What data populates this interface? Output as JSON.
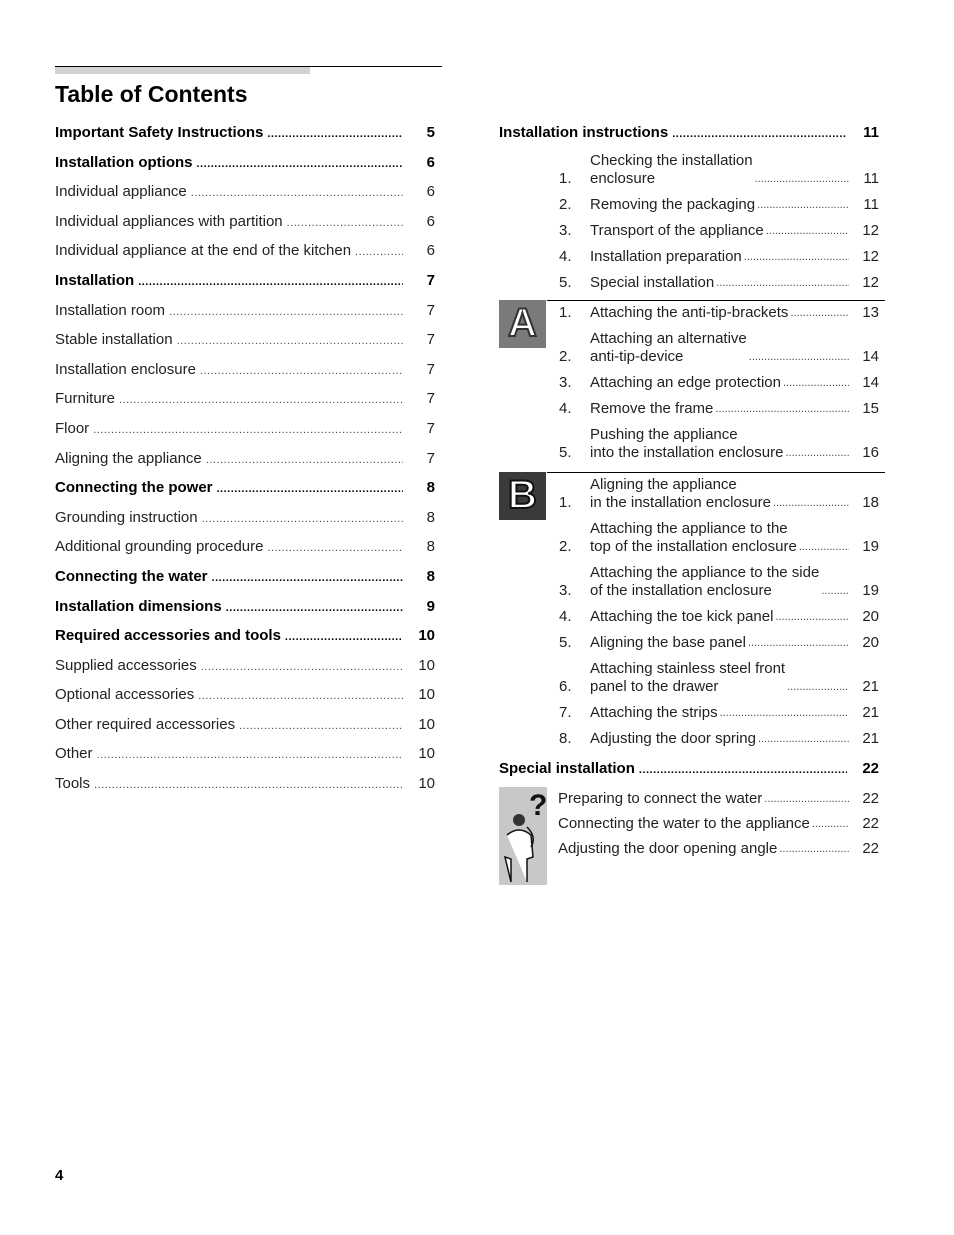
{
  "page": {
    "title": "Table of Contents",
    "page_number": "4"
  },
  "left": [
    {
      "label": "Important Safety Instructions",
      "page": "5",
      "bold": true
    },
    {
      "label": "Installation options",
      "page": "6",
      "bold": true
    },
    {
      "label": "Individual appliance",
      "page": "6",
      "bold": false
    },
    {
      "label": "Individual appliances with partition",
      "page": "6",
      "bold": false
    },
    {
      "label": "Individual appliance at the end of the kitchen",
      "page": "6",
      "bold": false
    },
    {
      "label": "Installation",
      "page": "7",
      "bold": true
    },
    {
      "label": "Installation room",
      "page": "7",
      "bold": false
    },
    {
      "label": "Stable installation",
      "page": "7",
      "bold": false
    },
    {
      "label": "Installation enclosure",
      "page": "7",
      "bold": false
    },
    {
      "label": "Furniture",
      "page": "7",
      "bold": false
    },
    {
      "label": "Floor",
      "page": "7",
      "bold": false
    },
    {
      "label": "Aligning the appliance",
      "page": "7",
      "bold": false
    },
    {
      "label": "Connecting the power",
      "page": "8",
      "bold": true
    },
    {
      "label": "Grounding instruction",
      "page": "8",
      "bold": false
    },
    {
      "label": "Additional grounding procedure",
      "page": "8",
      "bold": false
    },
    {
      "label": "Connecting the water",
      "page": "8",
      "bold": true
    },
    {
      "label": "Installation dimensions",
      "page": "9",
      "bold": true
    },
    {
      "label": "Required accessories and tools",
      "page": "10",
      "bold": true
    },
    {
      "label": "Supplied accessories",
      "page": "10",
      "bold": false
    },
    {
      "label": "Optional accessories",
      "page": "10",
      "bold": false
    },
    {
      "label": "Other required accessories",
      "page": "10",
      "bold": false
    },
    {
      "label": "Other",
      "page": "10",
      "bold": false
    },
    {
      "label": "Tools",
      "page": "10",
      "bold": false
    }
  ],
  "right": {
    "installation": {
      "label": "Installation instructions",
      "page": "11",
      "items": [
        {
          "num": "1.",
          "lines": [
            "Checking the installation",
            "enclosure"
          ],
          "page": "11"
        },
        {
          "num": "2.",
          "lines": [
            "Removing the packaging"
          ],
          "page": "11"
        },
        {
          "num": "3.",
          "lines": [
            "Transport of the appliance"
          ],
          "page": "12"
        },
        {
          "num": "4.",
          "lines": [
            "Installation preparation"
          ],
          "page": "12"
        },
        {
          "num": "5.",
          "lines": [
            "Special installation"
          ],
          "page": "12"
        }
      ]
    },
    "section_a": {
      "badge": "A",
      "items": [
        {
          "num": "1.",
          "lines": [
            "Attaching the anti-tip-brackets"
          ],
          "page": "13"
        },
        {
          "num": "2.",
          "lines": [
            "Attaching an alternative",
            "anti-tip-device"
          ],
          "page": "14"
        },
        {
          "num": "3.",
          "lines": [
            "Attaching an edge protection"
          ],
          "page": "14"
        },
        {
          "num": "4.",
          "lines": [
            "Remove the frame"
          ],
          "page": "15"
        },
        {
          "num": "5.",
          "lines": [
            "Pushing the appliance",
            "into the installation enclosure"
          ],
          "page": "16"
        }
      ]
    },
    "section_b": {
      "badge": "B",
      "items": [
        {
          "num": "1.",
          "lines": [
            "Aligning the appliance",
            "in the installation enclosure"
          ],
          "page": "18"
        },
        {
          "num": "2.",
          "lines": [
            "Attaching the appliance to the",
            "top of the installation enclosure"
          ],
          "page": "19"
        },
        {
          "num": "3.",
          "lines": [
            "Attaching the appliance to the side",
            "of the installation enclosure"
          ],
          "page": "19"
        },
        {
          "num": "4.",
          "lines": [
            "Attaching the toe kick panel"
          ],
          "page": "20"
        },
        {
          "num": "5.",
          "lines": [
            "Aligning the base panel"
          ],
          "page": "20"
        },
        {
          "num": "6.",
          "lines": [
            "Attaching stainless steel front",
            "panel to the drawer"
          ],
          "page": "21"
        },
        {
          "num": "7.",
          "lines": [
            "Attaching the strips"
          ],
          "page": "21"
        },
        {
          "num": "8.",
          "lines": [
            "Adjusting the door spring"
          ],
          "page": "21"
        }
      ]
    },
    "special": {
      "label": "Special installation",
      "page": "22",
      "items": [
        {
          "label": "Preparing to connect the water",
          "page": "22"
        },
        {
          "label": "Connecting the water to the appliance",
          "page": "22"
        },
        {
          "label": "Adjusting the door opening angle",
          "page": "22"
        }
      ]
    }
  }
}
